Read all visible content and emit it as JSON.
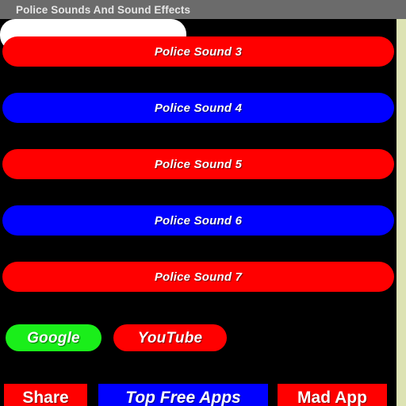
{
  "window": {
    "title": "Police Sounds And Sound Effects",
    "titlebar_color": "#6b6b6b",
    "background_color": "#000000",
    "edge_strip_color": "#dde3b4"
  },
  "colors": {
    "red": "#ff0000",
    "blue": "#0000ff",
    "green": "#1aee1a",
    "white": "#ffffff",
    "text": "#ffffff"
  },
  "main": {
    "partial_button": {
      "label": "",
      "color": "#ffffff",
      "note": "cut-off button above Police Sound 3"
    },
    "sound_buttons": [
      {
        "label": "Police Sound 3",
        "color": "#ff0000"
      },
      {
        "label": "Police Sound 4",
        "color": "#0000ff"
      },
      {
        "label": "Police Sound 5",
        "color": "#ff0000"
      },
      {
        "label": "Police Sound 6",
        "color": "#0000ff"
      },
      {
        "label": "Police Sound 7",
        "color": "#ff0000"
      }
    ],
    "link_buttons": [
      {
        "label": "Google",
        "color": "#1aee1a"
      },
      {
        "label": "YouTube",
        "color": "#ff0000"
      }
    ],
    "footer_buttons": [
      {
        "label": "Share",
        "color": "#ff0000"
      },
      {
        "label": "Top Free Apps",
        "color": "#0000ff"
      },
      {
        "label": "Mad App",
        "color": "#ff0000"
      }
    ]
  }
}
